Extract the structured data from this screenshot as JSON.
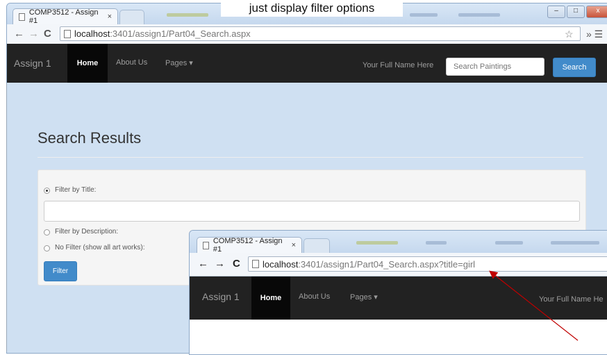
{
  "callout": "just display filter options",
  "browser_back": {
    "tab_title": "COMP3512 - Assign #1",
    "tab_close": "×",
    "url_host": "localhost",
    "url_rest": ":3401/assign1/Part04_Search.aspx",
    "win_min": "–",
    "win_max": "□",
    "win_close": "x"
  },
  "page_back": {
    "brand": "Assign 1",
    "nav": [
      "Home",
      "About Us",
      "Pages ▾"
    ],
    "full_name": "Your Full Name Here",
    "search_placeholder": "Search Paintings",
    "search_button": "Search",
    "title": "Search Results",
    "options": [
      {
        "label": "Filter by Title:",
        "checked": true
      },
      {
        "label": "Filter by Description:",
        "checked": false
      },
      {
        "label": "No Filter (show all art works):",
        "checked": false
      }
    ],
    "filter_button": "Filter"
  },
  "browser_front": {
    "tab_title": "COMP3512 - Assign #1",
    "tab_close": "×",
    "url_host": "localhost",
    "url_rest": ":3401/assign1/Part04_Search.aspx?title=girl"
  },
  "page_front": {
    "brand": "Assign 1",
    "nav": [
      "Home",
      "About Us",
      "Pages ▾"
    ],
    "full_name": "Your Full Name He"
  },
  "colors": {
    "navbar": "#222222",
    "primary": "#428bca",
    "arrow": "#c00000"
  }
}
